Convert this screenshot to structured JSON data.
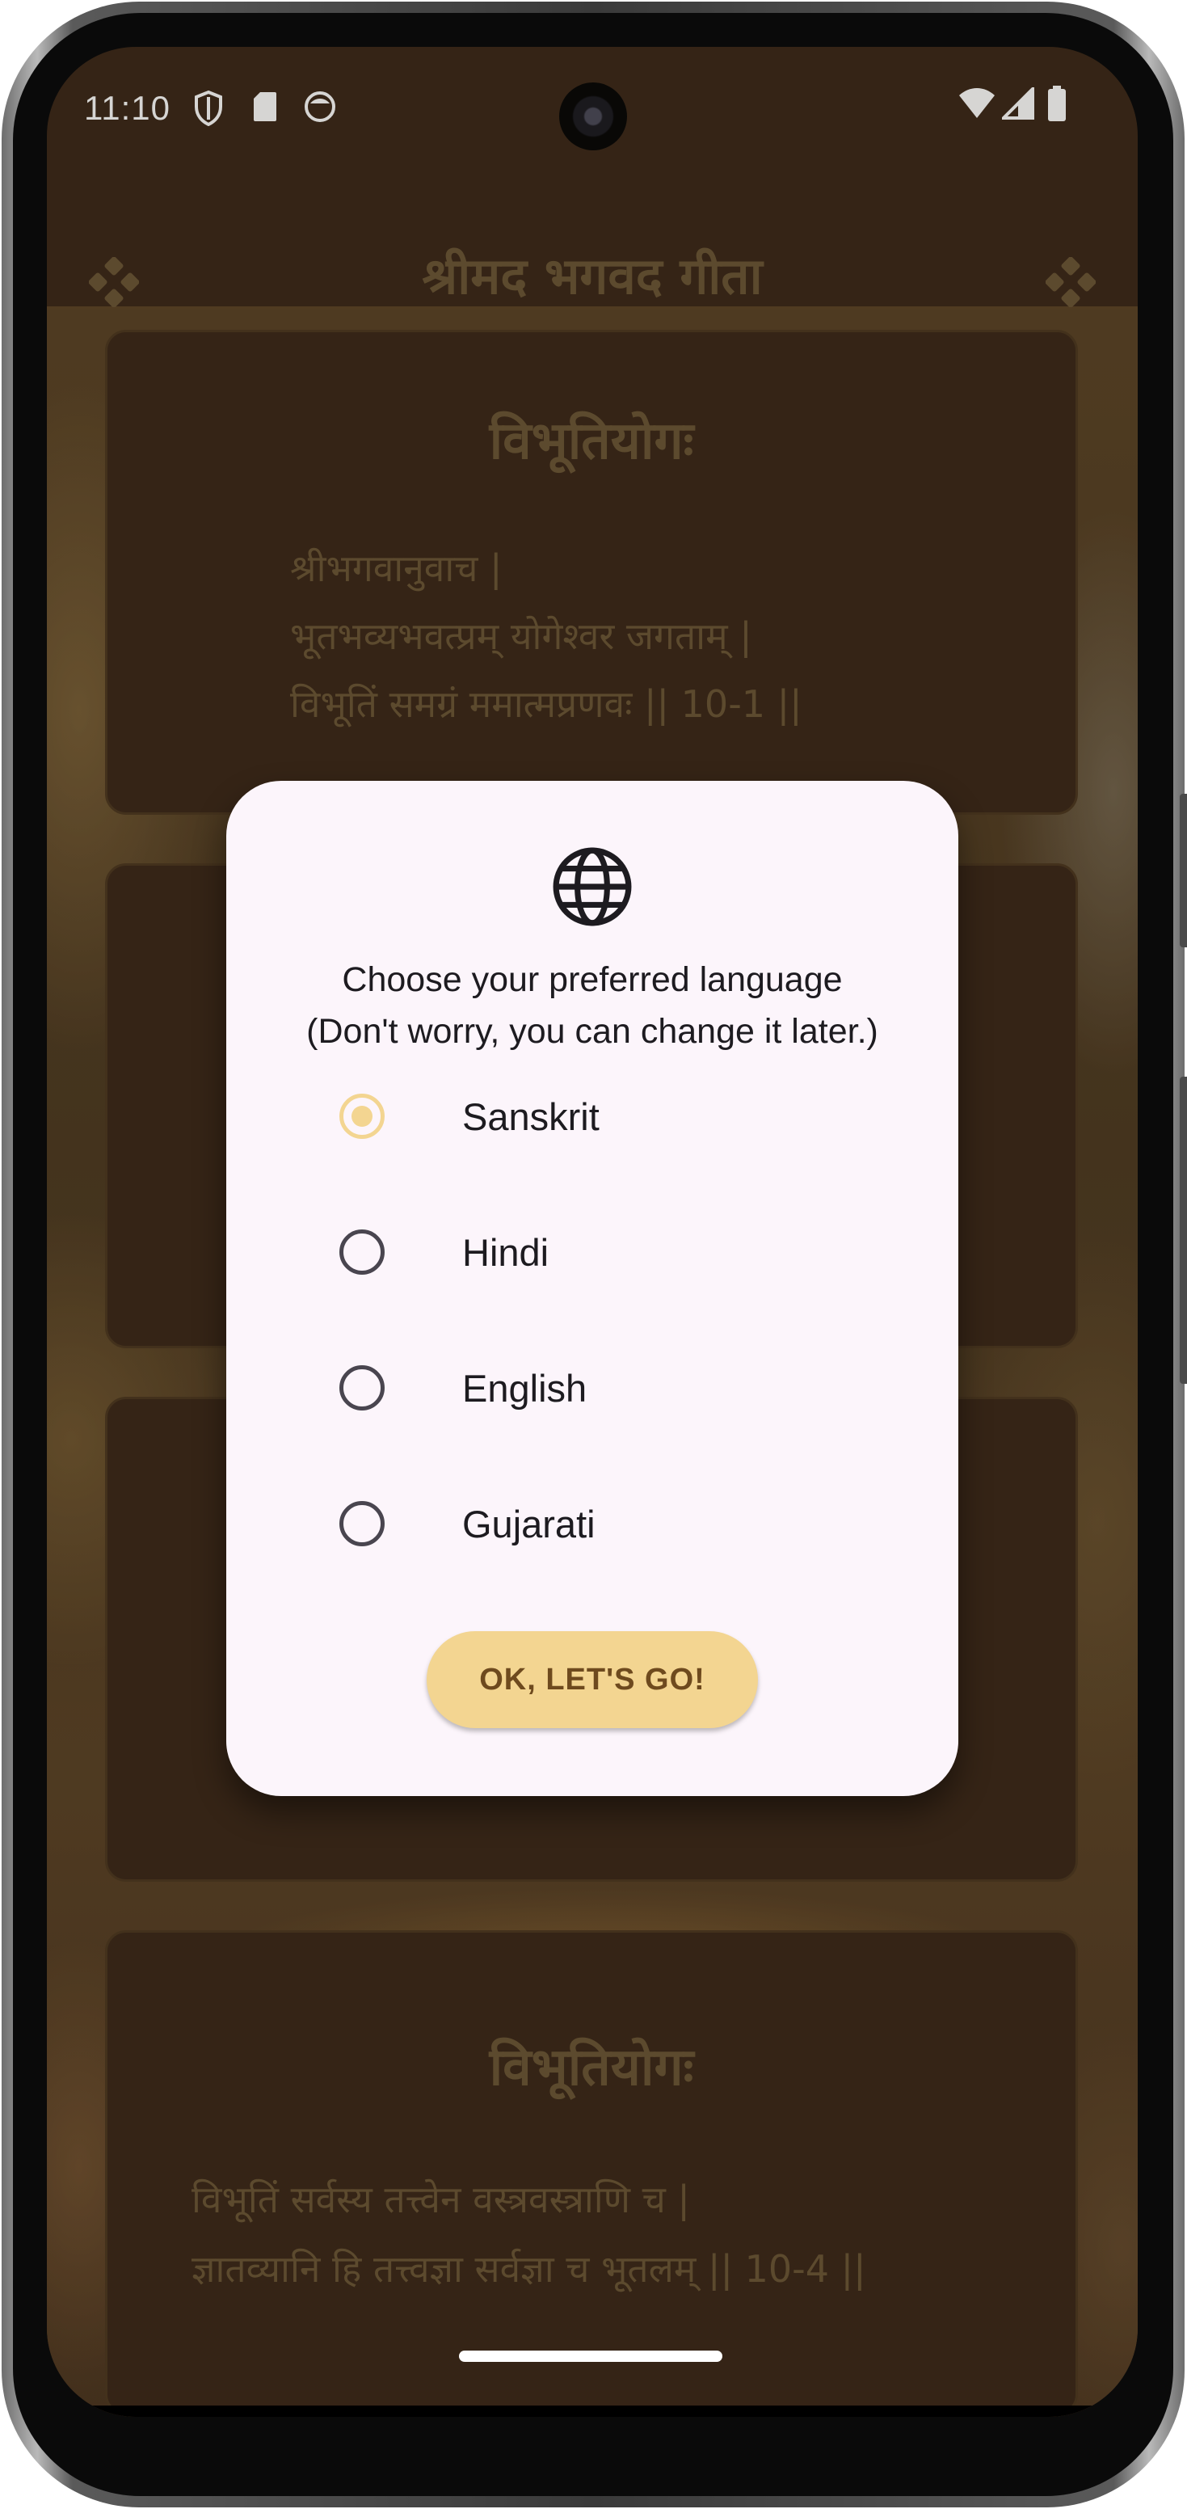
{
  "status_bar": {
    "time": "11:10",
    "left_icons": [
      "shield-icon",
      "sd-card-icon",
      "app-notification-icon"
    ],
    "right_icons": [
      "wifi-icon",
      "cell-signal-icon",
      "battery-icon"
    ]
  },
  "app_bar": {
    "title": "श्रीमद भगवद गीता",
    "left_icon": "flower-ornament-icon",
    "right_icon": "flower-ornament-icon"
  },
  "cards": [
    {
      "title": "विभूतियोगः",
      "lines": [
        "श्रीभगवानुवाच |",
        "भूतभव्यभवत्प्रम् योगेश्वर जगताम् |",
        "विभूतिं समग्रं ममात्मप्रणवः || 10-1 ||"
      ]
    },
    {
      "title": "विभूतियोगः",
      "lines": [
        "विभूतिं सर्वस्य तत्त्वेन वस्त्रवस्त्राणि च |",
        "ज्ञातव्यानि हि तत्त्वज्ञा सर्वज्ञा च भूतलम् || 10-4 ||"
      ]
    }
  ],
  "dialog": {
    "icon": "globe-icon",
    "message_line1": "Choose your preferred language",
    "message_line2": "(Don't worry, you can change it later.)",
    "options": [
      {
        "label": "Sanskrit",
        "selected": true
      },
      {
        "label": "Hindi",
        "selected": false
      },
      {
        "label": "English",
        "selected": false
      },
      {
        "label": "Gujarati",
        "selected": false
      }
    ],
    "ok_label": "OK, LET'S GO!"
  },
  "colors": {
    "app_background": "#3b2819",
    "muted_text": "#6b5636",
    "dialog_surface": "#fcf5fb",
    "accent": "#f3d591",
    "button_text": "#6e4a1e"
  }
}
